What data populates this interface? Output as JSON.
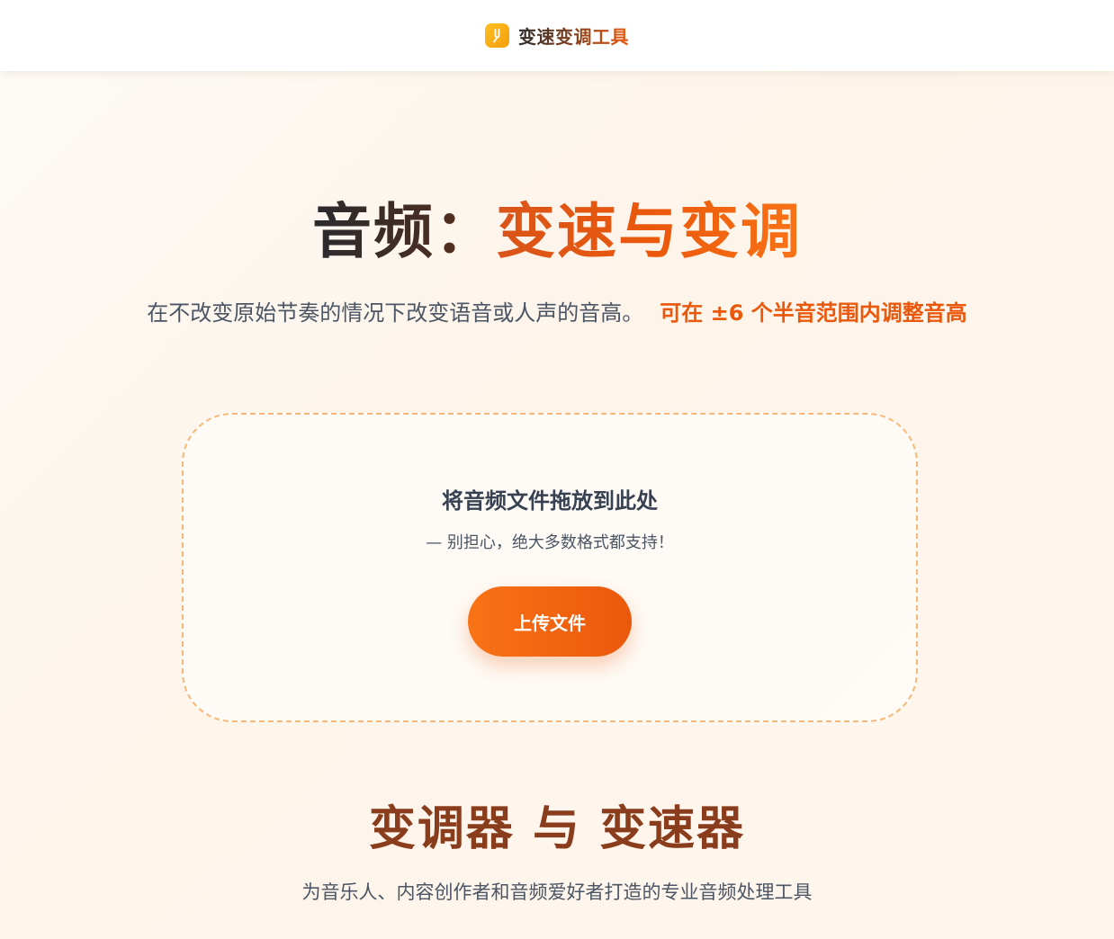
{
  "header": {
    "logo_icon": "tuning-fork-icon",
    "brand": "变速变调工具"
  },
  "hero": {
    "title_part1": "音频：",
    "title_part2": "变速与变调",
    "subtitle": "在不改变原始节奏的情况下改变语音或人声的音高。",
    "highlight": "可在 ±6 个半音范围内调整音高"
  },
  "dropzone": {
    "title": "将音频文件拖放到此处",
    "subtitle": "— 别担心，绝大多数格式都支持！",
    "upload_label": "上传文件"
  },
  "section": {
    "title": "变调器 与 变速器",
    "subtitle": "为音乐人、内容创作者和音频爱好者打造的专业音频处理工具"
  },
  "colors": {
    "accent": "#ea580c",
    "accent_light": "#f97316",
    "section_title": "#8a3d1c",
    "dropzone_border": "#f7b877"
  }
}
